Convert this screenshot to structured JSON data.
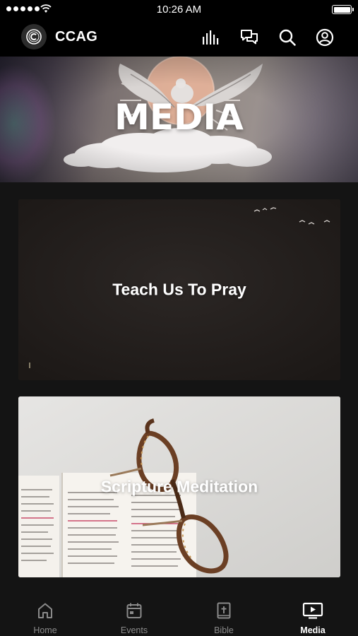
{
  "status_bar": {
    "time": "10:26 AM"
  },
  "header": {
    "app_title": "CCAG",
    "icons": [
      "logo-icon",
      "audio-bars-icon",
      "chat-icon",
      "search-icon",
      "account-icon"
    ]
  },
  "hero": {
    "title": "MEDIA"
  },
  "cards": [
    {
      "title": "Teach Us To Pray"
    },
    {
      "title": "Scripture Meditation"
    }
  ],
  "tab_bar": {
    "tabs": [
      {
        "label": "Home",
        "icon": "home-icon",
        "active": false
      },
      {
        "label": "Events",
        "icon": "calendar-icon",
        "active": false
      },
      {
        "label": "Bible",
        "icon": "bible-icon",
        "active": false
      },
      {
        "label": "Media",
        "icon": "media-tv-icon",
        "active": true
      }
    ]
  },
  "colors": {
    "background": "#141414",
    "header_background": "#000000",
    "tab_inactive": "#8a8a8a",
    "tab_active": "#ffffff"
  }
}
